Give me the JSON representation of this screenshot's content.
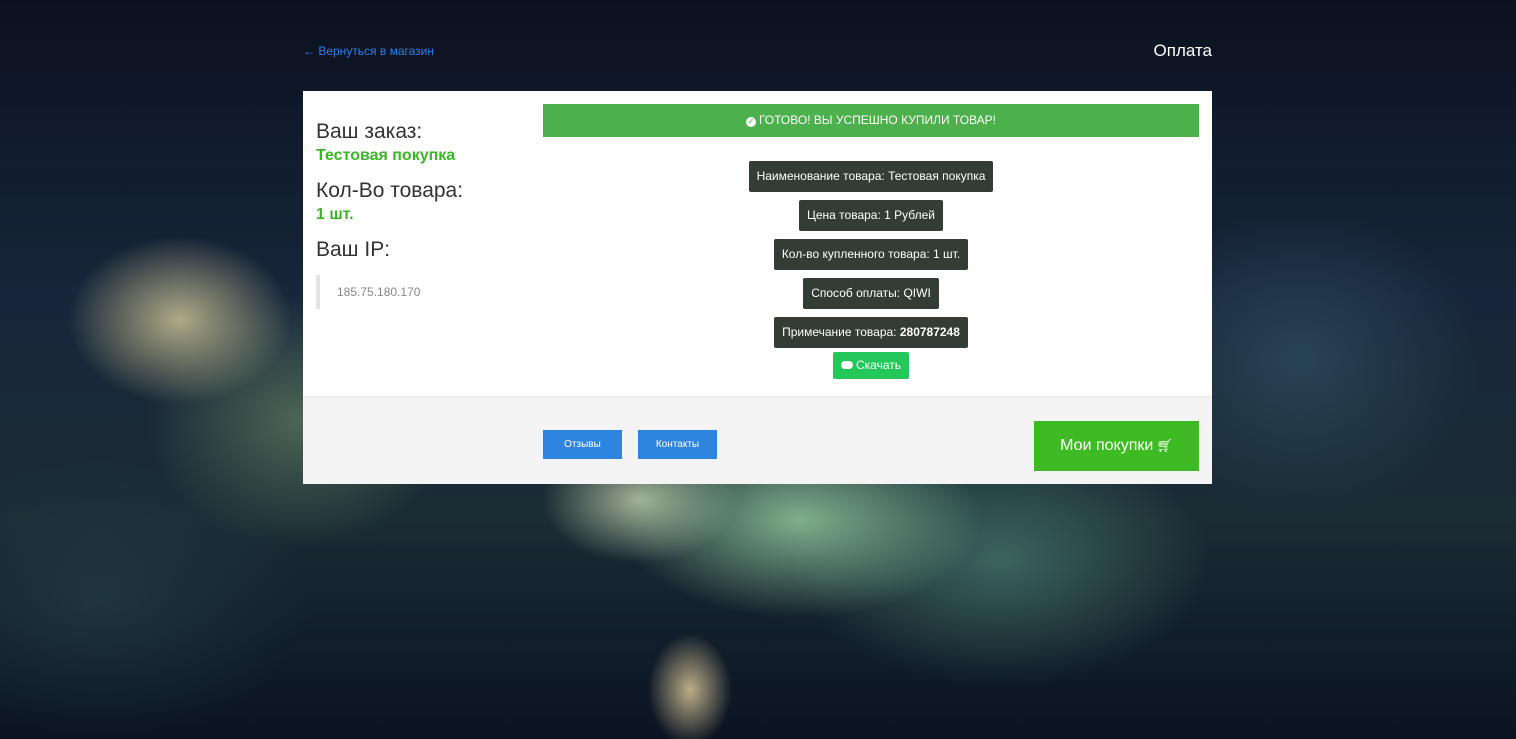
{
  "header": {
    "back_link": "← Вернуться в магазин",
    "title": "Оплата"
  },
  "order": {
    "order_label": "Ваш заказ:",
    "order_value": "Тестовая покупка",
    "qty_label": "Кол-Во товара:",
    "qty_value": "1 шт.",
    "ip_label": "Ваш IP:",
    "ip_value": "185.75.180.170"
  },
  "success": {
    "icon": "check-circle-icon",
    "message": "ГОТОВО! ВЫ УСПЕШНО КУПИЛИ ТОВАР!"
  },
  "details": {
    "name": "Наименование товара: Тестовая покупка",
    "price": "Цена товара: 1 Рублей",
    "qty": "Кол-во купленного товара: 1 шт.",
    "payment": "Способ оплаты: QIWI",
    "note_label": "Примечание товара: ",
    "note_value": "280787248"
  },
  "download": {
    "icon": "cloud-download-icon",
    "label": "Скачать"
  },
  "footer": {
    "reviews": "Отзывы",
    "contacts": "Контакты",
    "purchases": "Мои покупки",
    "purchases_icon": "cart-icon"
  },
  "colors": {
    "accent_green": "#4cb04c",
    "value_green": "#3db52a",
    "button_blue": "#2e85e0",
    "chip_dark": "#333d35"
  }
}
